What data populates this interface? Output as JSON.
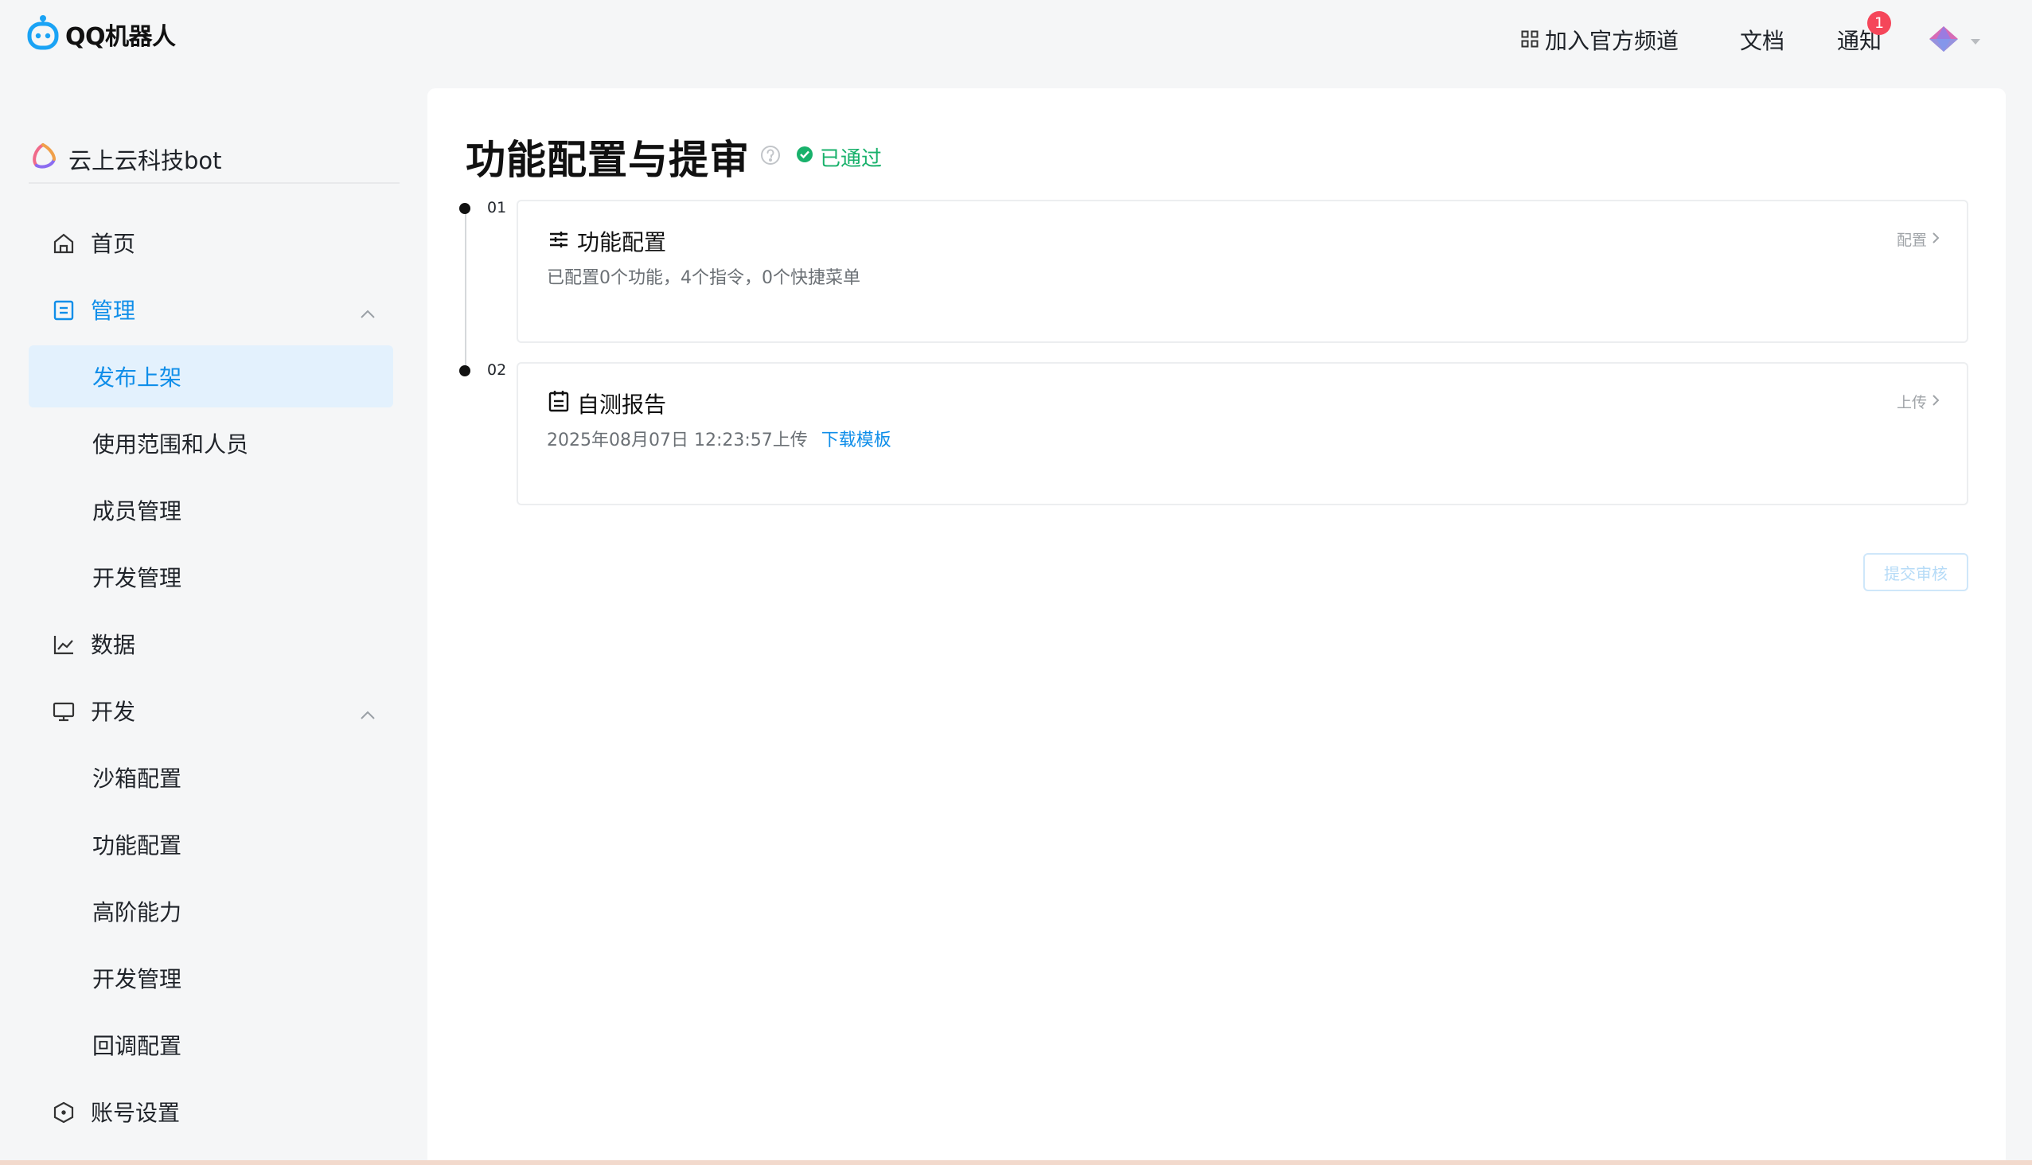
{
  "app": {
    "logo_text": "QQ机器人",
    "logo_icon": "robot-icon"
  },
  "top_nav": {
    "join_label": "加入官方频道",
    "docs_label": "文档",
    "notice_label": "通知",
    "notice_badge": "1"
  },
  "sidebar": {
    "bot_name": "云上云科技bot",
    "items": [
      {
        "label": "首页",
        "icon": "home-icon"
      },
      {
        "label": "管理",
        "icon": "document-icon"
      },
      {
        "label": "发布上架"
      },
      {
        "label": "使用范围和人员"
      },
      {
        "label": "成员管理"
      },
      {
        "label": "开发管理"
      },
      {
        "label": "数据",
        "icon": "chart-icon"
      },
      {
        "label": "开发",
        "icon": "monitor-icon"
      },
      {
        "label": "沙箱配置"
      },
      {
        "label": "功能配置"
      },
      {
        "label": "高阶能力"
      },
      {
        "label": "开发管理"
      },
      {
        "label": "回调配置"
      },
      {
        "label": "账号设置",
        "icon": "hexagon-icon"
      }
    ]
  },
  "main": {
    "title": "功能配置与提审",
    "status": "已通过",
    "steps": [
      {
        "num": "01",
        "title": "功能配置",
        "icon": "sliders-icon",
        "desc": "已配置0个功能，4个指令，0个快捷菜单",
        "action": "配置"
      },
      {
        "num": "02",
        "title": "自测报告",
        "icon": "clipboard-icon",
        "desc": "2025年08月07日 12:23:57上传",
        "link": "下载模板",
        "action": "上传"
      }
    ],
    "submit_label": "提交审核"
  },
  "colors": {
    "accent": "#0f8ee9",
    "success": "#18b16b",
    "badge": "#f5465a",
    "active_bg": "#e3f1fd"
  }
}
